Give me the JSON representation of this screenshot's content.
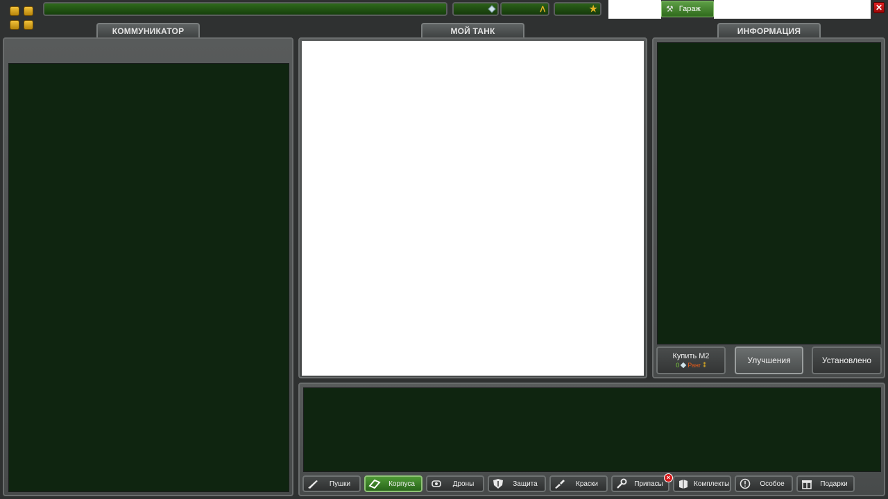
{
  "topbar": {
    "garage_label": "Гараж",
    "close_label": "✕"
  },
  "panels": {
    "communicator_title": "КОММУНИКАТОР",
    "my_tank_title": "МОЙ ТАНК",
    "info_title": "ИНФОРМАЦИЯ"
  },
  "info_buttons": {
    "buy_label": "Купить M2",
    "buy_crystals": "0",
    "buy_rank": "Ранг",
    "upgrades_label": "Улучшения",
    "installed_label": "Установлено"
  },
  "categories": [
    {
      "label": "Пушки",
      "icon": "gun-icon"
    },
    {
      "label": "Корпуса",
      "icon": "hull-icon"
    },
    {
      "label": "Дроны",
      "icon": "drone-icon"
    },
    {
      "label": "Защита",
      "icon": "shield-icon"
    },
    {
      "label": "Краски",
      "icon": "paint-icon"
    },
    {
      "label": "Припасы",
      "icon": "wrench-icon"
    },
    {
      "label": "Комплекты",
      "icon": "kit-icon"
    },
    {
      "label": "Особое",
      "icon": "special-icon"
    },
    {
      "label": "Подарки",
      "icon": "gift-icon"
    }
  ],
  "colors": {
    "accent_green": "#3f8a2a",
    "panel_dark_green": "#0f2510",
    "frame_gray": "#4f5252",
    "gold": "#e6b422",
    "danger_red": "#d61a1a"
  }
}
